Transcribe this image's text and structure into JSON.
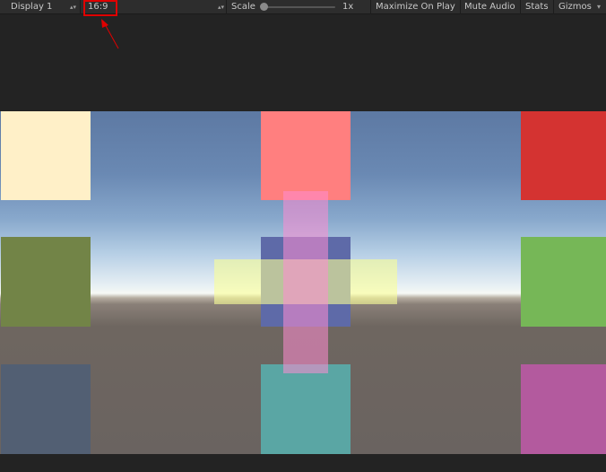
{
  "toolbar": {
    "display_label": "Display 1",
    "aspect_label": "16:9",
    "scale_label": "Scale",
    "scale_value": "1x",
    "maximize_label": "Maximize On Play",
    "mute_label": "Mute Audio",
    "stats_label": "Stats",
    "gizmos_label": "Gizmos",
    "scale_slider_fraction": 0.0
  },
  "colors": {
    "toolbar_bg": "#2d2d2d",
    "annotation": "#e00000",
    "sky_top": "#5d79a3",
    "horizon": "#f6f8f4",
    "ground": "#6a6360"
  },
  "scene": {
    "squares": [
      {
        "name": "cream-square",
        "color": "#fff0c8"
      },
      {
        "name": "salmon-square",
        "color": "#ff7f7f"
      },
      {
        "name": "red-square",
        "color": "#d43331"
      },
      {
        "name": "olive-square",
        "color": "#728447"
      },
      {
        "name": "green-square",
        "color": "#76b757"
      },
      {
        "name": "slate-square",
        "color": "#525f73"
      },
      {
        "name": "teal-square",
        "color": "#5aa6a4"
      },
      {
        "name": "magenta-square",
        "color": "#b35a9e"
      }
    ]
  }
}
